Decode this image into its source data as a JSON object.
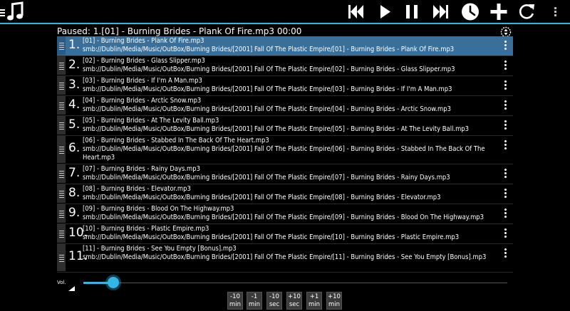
{
  "toolbar": {
    "app_icon": "music-note-icon",
    "buttons": [
      "skip-previous-icon",
      "play-icon",
      "pause-icon",
      "skip-next-icon",
      "sleep-timer-icon",
      "add-icon",
      "refresh-icon",
      "overflow-menu-icon"
    ]
  },
  "now_playing": "Paused: 1.[01] - Burning Brides - Plank Of Fire.mp3  00:00",
  "playlist": [
    {
      "num": "1.",
      "title": "[01] - Burning Brides - Plank Of Fire.mp3",
      "path": "smb://Dublin/Media/Music/OutBox/Burning Brides/[2001] Fall Of The Plastic Empire/[01] - Burning Brides - Plank Of Fire.mp3",
      "active": true
    },
    {
      "num": "2.",
      "title": "[02] - Burning Brides - Glass Slipper.mp3",
      "path": "smb://Dublin/Media/Music/OutBox/Burning Brides/[2001] Fall Of The Plastic Empire/[02] - Burning Brides - Glass Slipper.mp3"
    },
    {
      "num": "3.",
      "title": "[03] - Burning Brides - If I'm A Man.mp3",
      "path": "smb://Dublin/Media/Music/OutBox/Burning Brides/[2001] Fall Of The Plastic Empire/[03] - Burning Brides - If I'm A Man.mp3"
    },
    {
      "num": "4.",
      "title": "[04] - Burning Brides - Arctic Snow.mp3",
      "path": "smb://Dublin/Media/Music/OutBox/Burning Brides/[2001] Fall Of The Plastic Empire/[04] - Burning Brides - Arctic Snow.mp3"
    },
    {
      "num": "5.",
      "title": "[05] - Burning Brides - At The Levity Ball.mp3",
      "path": "smb://Dublin/Media/Music/OutBox/Burning Brides/[2001] Fall Of The Plastic Empire/[05] - Burning Brides - At The Levity Ball.mp3"
    },
    {
      "num": "6.",
      "title": "[06] - Burning Brides - Stabbed In The Back Of The Heart.mp3",
      "path": "smb://Dublin/Media/Music/OutBox/Burning Brides/[2001] Fall Of The Plastic Empire/[06] - Burning Brides - Stabbed In The Back Of The Heart.mp3"
    },
    {
      "num": "7.",
      "title": "[07] - Burning Brides - Rainy Days.mp3",
      "path": "smb://Dublin/Media/Music/OutBox/Burning Brides/[2001] Fall Of The Plastic Empire/[07] - Burning Brides - Rainy Days.mp3"
    },
    {
      "num": "8.",
      "title": "[08] - Burning Brides - Elevator.mp3",
      "path": "smb://Dublin/Media/Music/OutBox/Burning Brides/[2001] Fall Of The Plastic Empire/[08] - Burning Brides - Elevator.mp3"
    },
    {
      "num": "9.",
      "title": "[09] - Burning Brides - Blood On The Highway.mp3",
      "path": "smb://Dublin/Media/Music/OutBox/Burning Brides/[2001] Fall Of The Plastic Empire/[09] - Burning Brides - Blood On The Highway.mp3"
    },
    {
      "num": "10.",
      "title": "[10] - Burning Brides - Plastic Empire.mp3",
      "path": "smb://Dublin/Media/Music/OutBox/Burning Brides/[2001] Fall Of The Plastic Empire/[10] - Burning Brides - Plastic Empire.mp3"
    },
    {
      "num": "11.",
      "title": "[11] - Burning Brides - See You Empty [Bonus].mp3",
      "path": "smb://Dublin/Media/Music/OutBox/Burning Brides/[2001] Fall Of The Plastic Empire/[11] - Burning Brides - See You Empty [Bonus].mp3"
    }
  ],
  "volume": {
    "label": "Vol.",
    "level": 0.07
  },
  "seek_buttons": [
    {
      "amount": "-10",
      "unit": "min"
    },
    {
      "amount": "-1",
      "unit": "min"
    },
    {
      "amount": "-10",
      "unit": "sec"
    },
    {
      "amount": "+10",
      "unit": "sec"
    },
    {
      "amount": "+1",
      "unit": "min"
    },
    {
      "amount": "+10",
      "unit": "min"
    }
  ],
  "colors": {
    "accent": "#33b5e5",
    "active_row": "#3a6f99",
    "background": "#000000"
  }
}
